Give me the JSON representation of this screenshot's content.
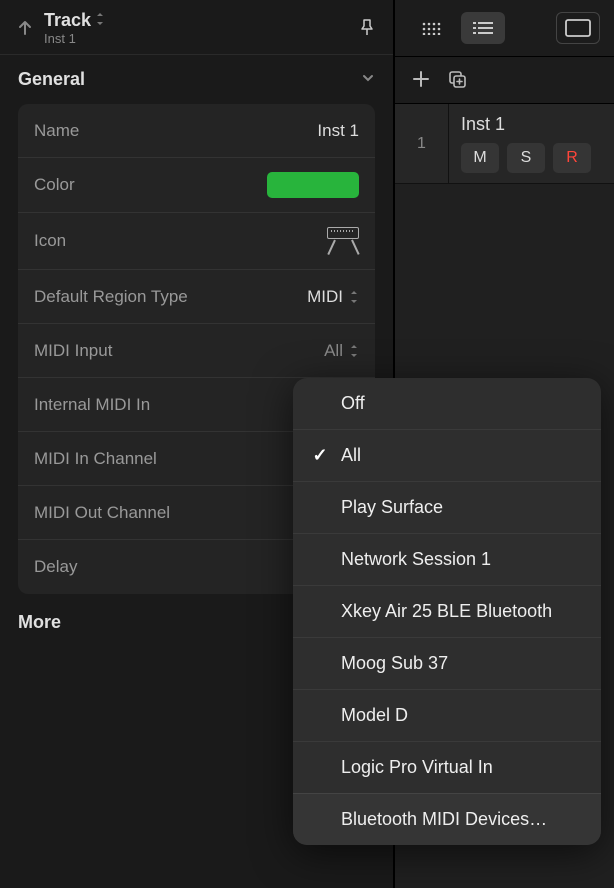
{
  "inspector": {
    "title": "Track",
    "subtitle": "Inst 1",
    "sections": {
      "general": {
        "title": "General",
        "name": {
          "label": "Name",
          "value": "Inst 1"
        },
        "color": {
          "label": "Color",
          "value": "#28b43c"
        },
        "icon": {
          "label": "Icon"
        },
        "region_type": {
          "label": "Default Region Type",
          "value": "MIDI"
        },
        "midi_input": {
          "label": "MIDI Input",
          "value": "All"
        },
        "internal_midi": {
          "label": "Internal MIDI In"
        },
        "midi_in_ch": {
          "label": "MIDI In Channel"
        },
        "midi_out_ch": {
          "label": "MIDI Out Channel"
        },
        "delay": {
          "label": "Delay"
        }
      },
      "more": {
        "title": "More"
      }
    }
  },
  "tracks": {
    "rows": [
      {
        "num": "1",
        "name": "Inst 1",
        "mute": "M",
        "solo": "S",
        "rec": "R"
      }
    ]
  },
  "menu": {
    "items": [
      {
        "label": "Off",
        "checked": false
      },
      {
        "label": "All",
        "checked": true
      },
      {
        "label": "Play Surface",
        "checked": false
      },
      {
        "label": "Network Session 1",
        "checked": false
      },
      {
        "label": "Xkey Air 25 BLE Bluetooth",
        "checked": false
      },
      {
        "label": "Moog Sub 37",
        "checked": false
      },
      {
        "label": "Model D",
        "checked": false
      },
      {
        "label": "Logic Pro Virtual In",
        "checked": false
      },
      {
        "label": "Bluetooth MIDI Devices…",
        "checked": false
      }
    ]
  }
}
